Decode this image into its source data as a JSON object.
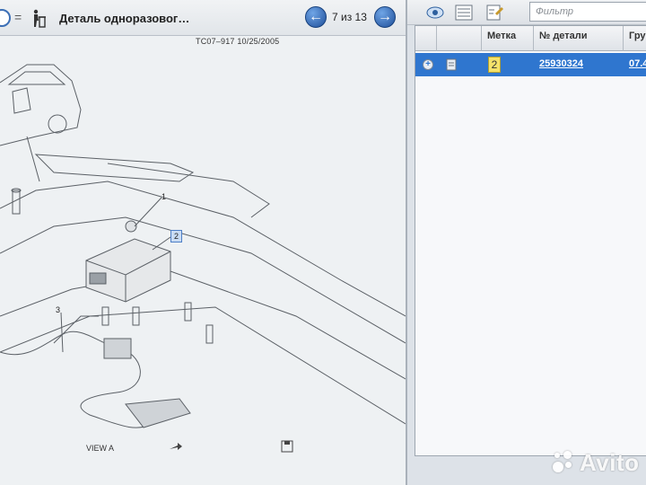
{
  "left_toolbar": {
    "eq_sign": "=",
    "part_title": "Деталь одноразовог…",
    "page_counter": "7 из 13",
    "prev_icon": "arrow-left-icon",
    "next_icon": "arrow-right-icon"
  },
  "illustration": {
    "header": "TC07–917  10/25/2005",
    "callouts": [
      "1",
      "2",
      "3"
    ],
    "footer_view": "VIEW A"
  },
  "right_toolbar": {
    "icons": [
      "eye-icon",
      "list-icon",
      "notes-icon"
    ],
    "filter_placeholder": "Фильтр"
  },
  "parts_table": {
    "columns": [
      "",
      "",
      "Метка",
      "№ детали",
      "Груп"
    ],
    "rows": [
      {
        "mark": "2",
        "part_no": "25930324",
        "group": "07.4"
      }
    ],
    "selected_color": "#2f76cf"
  },
  "watermark": "Avito"
}
